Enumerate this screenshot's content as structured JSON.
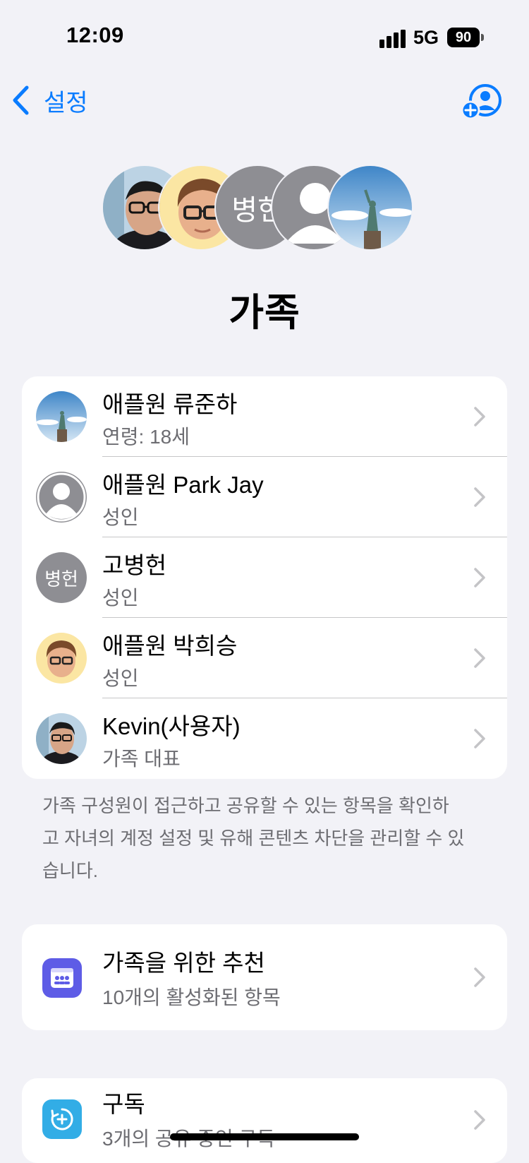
{
  "status_bar": {
    "time": "12:09",
    "network": "5G",
    "battery": "90"
  },
  "nav": {
    "back_label": "설정"
  },
  "avatars_stack": {
    "initials": "병헌"
  },
  "page_title": "가족",
  "members": [
    {
      "name": "애플원 류준하",
      "subtitle": "연령: 18세",
      "avatar": "statue-photo"
    },
    {
      "name": "애플원 Park Jay",
      "subtitle": "성인",
      "avatar": "person-placeholder"
    },
    {
      "name": "고병헌",
      "subtitle": "성인",
      "avatar": "initials",
      "initials": "병헌"
    },
    {
      "name": "애플원 박희승",
      "subtitle": "성인",
      "avatar": "memoji"
    },
    {
      "name": "Kevin(사용자)",
      "subtitle": "가족 대표",
      "avatar": "selfie-photo"
    }
  ],
  "footnote": "가족 구성원이 접근하고 공유할 수 있는 항목을 확인하고 자녀의 계정 설정 및 유해 콘텐츠 차단을 관리할 수 있습니다.",
  "features": [
    {
      "title": "가족을 위한 추천",
      "subtitle": "10개의 활성화된 항목",
      "icon": "family-checklist-icon",
      "color": "#5e5ce6"
    },
    {
      "title": "구독",
      "subtitle": "3개의 공유 중인 구독",
      "icon": "subscription-add-icon",
      "color": "#32ade6"
    }
  ],
  "colors": {
    "accent": "#0a7cff",
    "background": "#f2f2f7",
    "secondary_text": "#6d6d72"
  }
}
